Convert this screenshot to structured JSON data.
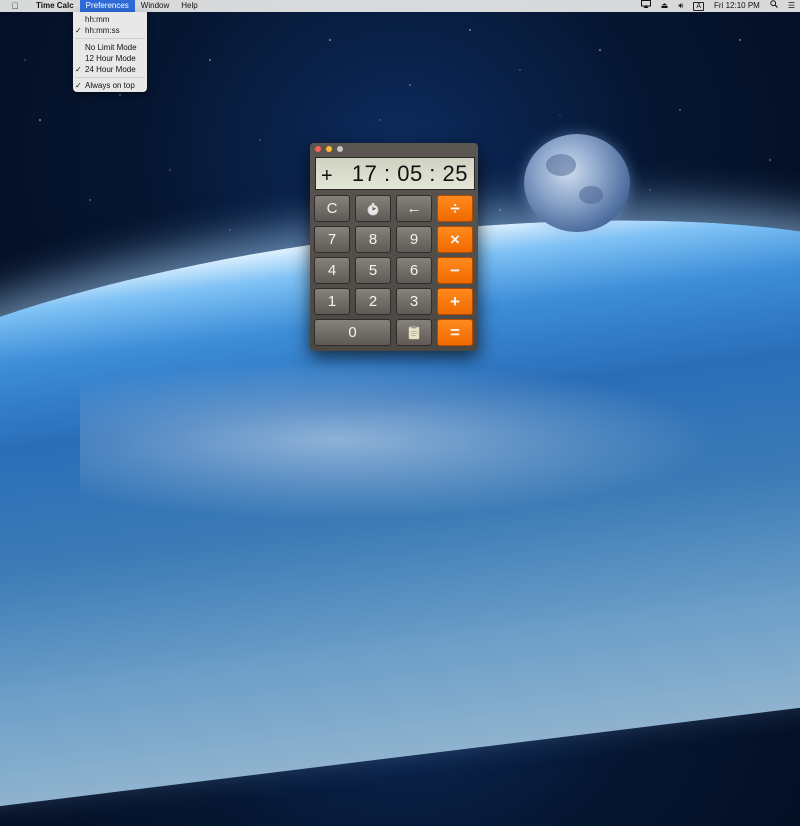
{
  "menubar": {
    "app_name": "Time Calc",
    "menus": [
      "Preferences",
      "Window",
      "Help"
    ],
    "clock": "Fri 12:10 PM"
  },
  "preferences_menu": {
    "items": [
      {
        "label": "hh:mm",
        "checked": ""
      },
      {
        "label": "hh:mm:ss",
        "checked": "✓"
      },
      {
        "label": "No Limit Mode",
        "checked": ""
      },
      {
        "label": "12 Hour Mode",
        "checked": ""
      },
      {
        "label": "24 Hour Mode",
        "checked": "✓"
      },
      {
        "label": "Always on top",
        "checked": "✓"
      }
    ]
  },
  "calculator": {
    "operator": "+",
    "value": "17 : 05 : 25",
    "keys": {
      "clear": "C",
      "backspace": "←",
      "divide": "÷",
      "multiply": "×",
      "minus": "−",
      "plus": "+",
      "equals": "=",
      "d7": "7",
      "d8": "8",
      "d9": "9",
      "d4": "4",
      "d5": "5",
      "d6": "6",
      "d1": "1",
      "d2": "2",
      "d3": "3",
      "d0": "0"
    }
  },
  "colors": {
    "accent_orange": "#f57a0f",
    "menu_highlight": "#2d6ad7"
  }
}
